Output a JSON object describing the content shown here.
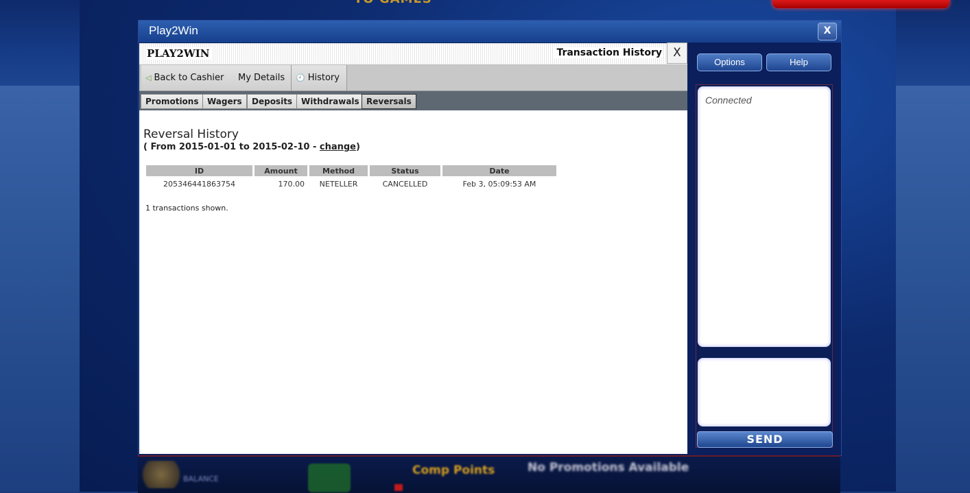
{
  "colors": {
    "window_blue": "#17408c",
    "panel_white": "#ffffff",
    "subnav_gray": "#5d6873",
    "accent_gold": "#d8a020",
    "accent_red": "#c01a1a"
  },
  "background": {
    "banner_text": "TO GAMES"
  },
  "window": {
    "title": "Play2Win",
    "close_label": "X"
  },
  "panel": {
    "brand": "PLAY2WIN",
    "title": "Transaction History",
    "close_label": "X"
  },
  "nav": {
    "items": [
      {
        "label": "Back to Cashier",
        "icon": "back-arrow-icon"
      },
      {
        "label": "My Details",
        "icon": ""
      },
      {
        "label": "History",
        "icon": "clock-icon"
      }
    ]
  },
  "subnav": {
    "items": [
      "Promotions",
      "Wagers",
      "Deposits",
      "Withdrawals",
      "Reversals"
    ],
    "active": "Reversals"
  },
  "reversal": {
    "heading": "Reversal History",
    "range_prefix": "( From 2015-01-01 to 2015-02-10 - ",
    "change_link": "change",
    "range_suffix": ")",
    "columns": [
      "ID",
      "Amount",
      "Method",
      "Status",
      "Date"
    ],
    "rows": [
      {
        "id": "205346441863754",
        "amount": "170.00",
        "method": "NETELLER",
        "status": "CANCELLED",
        "date": "Feb 3, 05:09:53 AM"
      }
    ],
    "summary": "1 transactions shown."
  },
  "side": {
    "options_label": "Options",
    "help_label": "Help",
    "chat_status": "Connected",
    "send_label": "SEND"
  },
  "footer": {
    "comp_label": "Comp Points",
    "promo_label": "No Promotions Available",
    "balance_label": "BALANCE"
  }
}
